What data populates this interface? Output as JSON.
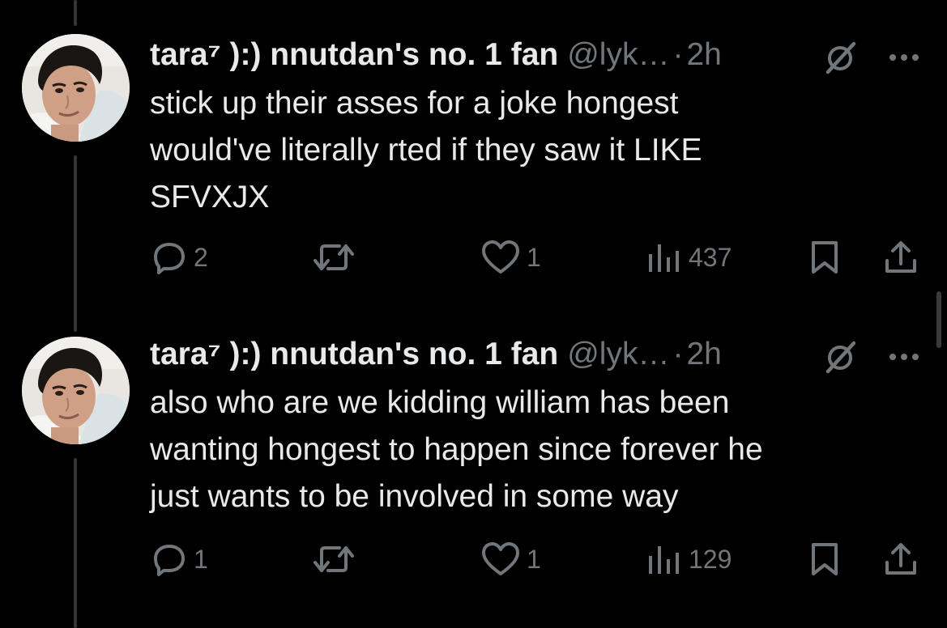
{
  "tweets": [
    {
      "display_name": "tara⁷ ):) nnutdan's no. 1 fan",
      "handle": "@lyk…",
      "separator": "·",
      "time": "2h",
      "text": "stick up their asses for a joke hongest\nwould've literally rted if they saw it LIKE\nSFVXJX",
      "replies": "2",
      "reposts": "",
      "likes": "1",
      "views": "437"
    },
    {
      "display_name": "tara⁷ ):) nnutdan's no. 1 fan",
      "handle": "@lyk…",
      "separator": "·",
      "time": "2h",
      "text": "also who are we kidding william has been\nwanting hongest to happen since forever he\njust wants to be involved in some way",
      "replies": "1",
      "reposts": "",
      "likes": "1",
      "views": "129"
    }
  ],
  "icons": {
    "reply": "reply-icon",
    "repost": "repost-icon",
    "like": "heart-icon",
    "views": "views-chart-icon",
    "bookmark": "bookmark-icon",
    "share": "share-icon",
    "grok": "grok-icon",
    "more": "more-icon"
  },
  "colors": {
    "background": "#000000",
    "text": "#e7e9ea",
    "muted": "#71767b",
    "thread_line": "#333639"
  }
}
